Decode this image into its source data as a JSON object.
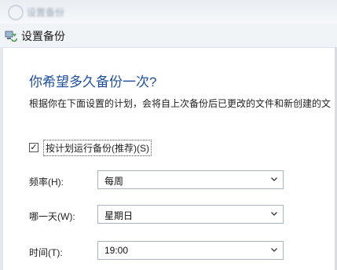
{
  "topbar": {
    "text": "设置备份"
  },
  "window": {
    "title": "设置备份"
  },
  "main": {
    "heading": "你希望多久备份一次?",
    "description": "根据你在下面设置的计划，会将自上次备份后已更改的文件和新创建的文"
  },
  "schedule_checkbox": {
    "label": "按计划运行备份(推荐)(S)",
    "checked": true,
    "check_mark": "✓"
  },
  "frequency": {
    "label": "频率(H):",
    "value": "每周"
  },
  "day": {
    "label": "哪一天(W):",
    "value": "星期日"
  },
  "time": {
    "label": "时间(T):",
    "value": "19:00"
  },
  "colors": {
    "heading": "#1f4e99"
  }
}
